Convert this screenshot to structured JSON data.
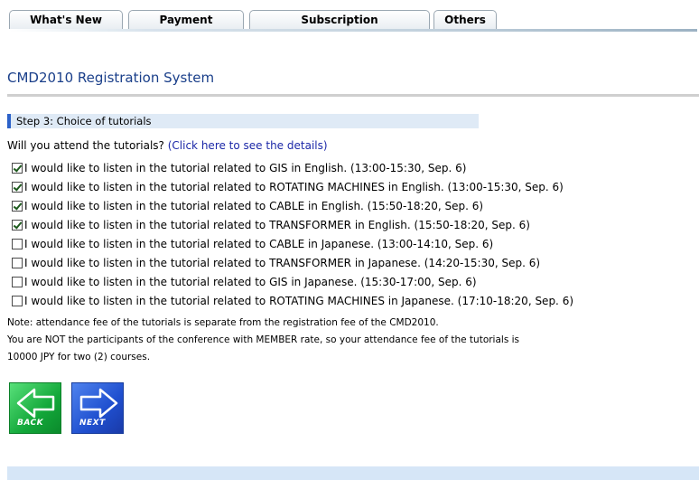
{
  "tabs": [
    {
      "label": "What's New"
    },
    {
      "label": "Payment"
    },
    {
      "label": "Subscription"
    },
    {
      "label": "Others"
    }
  ],
  "header": {
    "title": "CMD2010 Registration System"
  },
  "step": {
    "label": "Step 3: Choice of tutorials"
  },
  "question": {
    "text": "Will you attend the tutorials? ",
    "link": "(Click here to see the details)"
  },
  "options": [
    {
      "label": "I would like to listen in the tutorial related to GIS in English. (13:00-15:30, Sep. 6)",
      "checked": true
    },
    {
      "label": "I would like to listen in the tutorial related to ROTATING MACHINES in English. (13:00-15:30, Sep. 6)",
      "checked": true
    },
    {
      "label": "I would like to listen in the tutorial related to CABLE in English. (15:50-18:20, Sep. 6)",
      "checked": true
    },
    {
      "label": "I would like to listen in the tutorial related to TRANSFORMER in English. (15:50-18:20, Sep. 6)",
      "checked": true
    },
    {
      "label": "I would like to listen in the tutorial related to CABLE in Japanese. (13:00-14:10, Sep. 6)",
      "checked": false
    },
    {
      "label": "I would like to listen in the tutorial related to TRANSFORMER in Japanese. (14:20-15:30, Sep. 6)",
      "checked": false
    },
    {
      "label": "I would like to listen in the tutorial related to GIS in Japanese. (15:30-17:00, Sep. 6)",
      "checked": false
    },
    {
      "label": "I would like to listen in the tutorial related to ROTATING MACHINES in Japanese. (17:10-18:20, Sep. 6)",
      "checked": false
    }
  ],
  "notes": [
    "Note: attendance fee of the tutorials is separate from the registration fee of the CMD2010.",
    "You are NOT the participants of the conference with MEMBER rate, so your attendance fee of the tutorials is",
    "10000 JPY for two (2) courses."
  ],
  "nav": {
    "back_label": "BACK",
    "next_label": "NEXT",
    "back_icon": "arrow-left-icon",
    "next_icon": "arrow-right-icon"
  },
  "colors": {
    "title": "#1a3f8a",
    "link": "#1c28a8",
    "step_accent": "#2c62c9",
    "step_bg": "#dfeaf6",
    "back_button": "#13a83a",
    "next_button": "#1f4fcf",
    "footer_bar": "#d6e6f7"
  }
}
